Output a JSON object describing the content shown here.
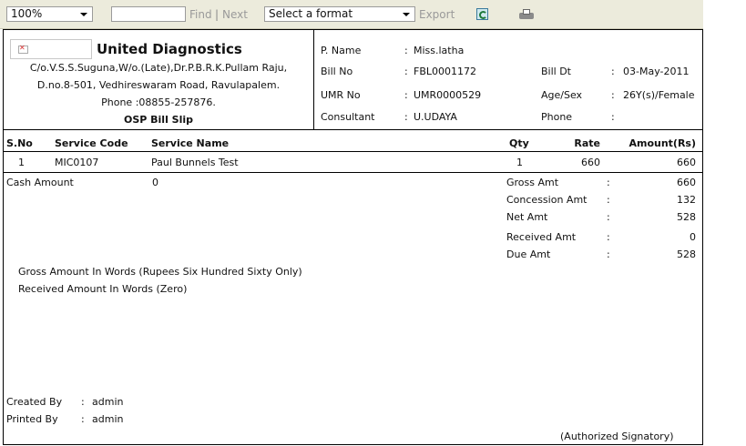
{
  "toolbar": {
    "zoom": "100%",
    "find_value": "",
    "find_label": "Find",
    "separator": "|",
    "next_label": "Next",
    "format_select": "Select a format",
    "export_label": "Export"
  },
  "header": {
    "company": "United Diagnostics",
    "address_line1": "C/o.V.S.S.Suguna,W/o.(Late),Dr.P.B.R.K.Pullam Raju,",
    "address_line2": "D.no.8-501, Vedhireswaram Road, Ravulapalem.",
    "phone_line": "Phone :08855-257876.",
    "slip_title": "OSP Bill Slip"
  },
  "patient": {
    "pname_label": "P. Name",
    "pname": "Miss.latha",
    "billno_label": "Bill No",
    "billno": "FBL0001172",
    "billdt_label": "Bill Dt",
    "billdt": "03-May-2011",
    "umr_label": "UMR No",
    "umr": "UMR0000529",
    "agesex_label": "Age/Sex",
    "agesex": "26Y(s)/Female",
    "consultant_label": "Consultant",
    "consultant": "U.UDAYA",
    "phone_label": "Phone",
    "phone": "",
    "colon": ":"
  },
  "table": {
    "headers": [
      "S.No",
      "Service Code",
      "Service Name",
      "Qty",
      "Rate",
      "Amount(Rs)"
    ],
    "rows": [
      [
        "1",
        "MIC0107",
        "Paul Bunnels Test",
        "1",
        "660",
        "660"
      ]
    ]
  },
  "summary": {
    "cash_label": "Cash Amount",
    "cash_value": "0",
    "gross_label": "Gross Amt",
    "gross": "660",
    "concession_label": "Concession Amt",
    "concession": "132",
    "net_label": "Net Amt",
    "net": "528",
    "received_label": "Received Amt",
    "received": "0",
    "due_label": "Due Amt",
    "due": "528",
    "gross_words": "Gross Amount In Words (Rupees Six Hundred Sixty Only)",
    "received_words": "Received Amount In Words (Zero)"
  },
  "footer": {
    "created_label": "Created By",
    "created": "admin",
    "printed_label": "Printed By",
    "printed": "admin",
    "signatory": "(Authorized Signatory)"
  }
}
